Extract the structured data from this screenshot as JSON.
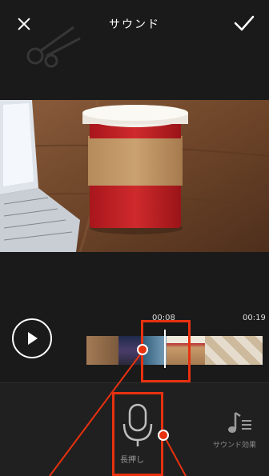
{
  "header": {
    "title": "サウンド",
    "close_icon": "close-icon",
    "confirm_icon": "check-icon",
    "watermark_icon": "scissors-icon"
  },
  "timeline": {
    "current_time": "00:08",
    "end_time": "00:19",
    "play_icon": "play-icon"
  },
  "tools": {
    "record_label": "長押し",
    "record_icon": "microphone-icon",
    "sound_effects_label": "サウンド効果",
    "sound_effects_icon": "music-note-icon"
  },
  "colors": {
    "background": "#1a1a1a",
    "accent_annotation": "#e8310f",
    "text": "#ffffff",
    "muted_text": "#9a9a9a"
  }
}
